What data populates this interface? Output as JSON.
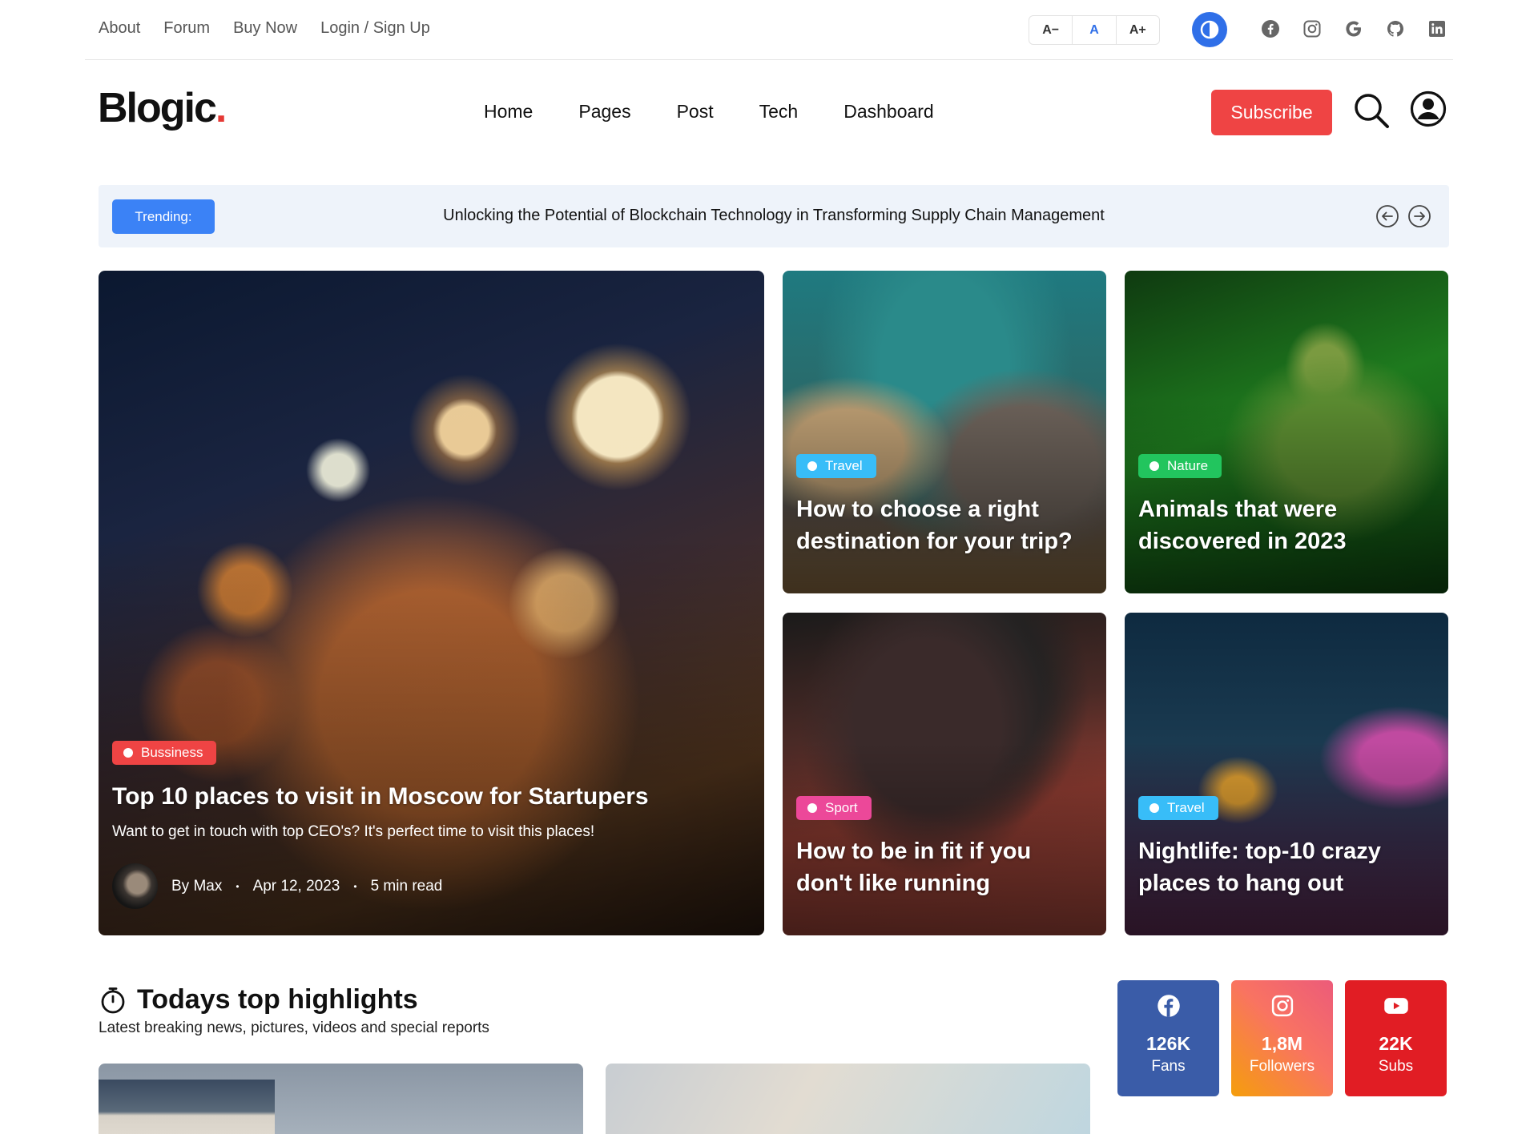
{
  "topbar": {
    "links": [
      "About",
      "Forum",
      "Buy Now",
      "Login / Sign Up"
    ],
    "font_size": {
      "decrease": "A−",
      "normal": "A",
      "increase": "A+"
    }
  },
  "header": {
    "logo": "Blogic",
    "logo_dot": ".",
    "nav": [
      "Home",
      "Pages",
      "Post",
      "Tech",
      "Dashboard"
    ],
    "subscribe_label": "Subscribe"
  },
  "trending": {
    "label": "Trending:",
    "headline": "Unlocking the Potential of Blockchain Technology in Transforming Supply Chain Management"
  },
  "featured": {
    "main": {
      "category": "Bussiness",
      "title": "Top 10 places to visit in Moscow for Startupers",
      "excerpt": "Want to get in touch with top CEO's? It's perfect time to visit this places!",
      "author": "By Max",
      "date": "Apr 12, 2023",
      "read_time": "5 min read",
      "meta_sep": "•"
    },
    "cards": [
      {
        "category": "Travel",
        "title": "How to choose a right destination for your trip?"
      },
      {
        "category": "Nature",
        "title": "Animals that were discovered in 2023"
      },
      {
        "category": "Sport",
        "title": "How to be in fit if you don't like running"
      },
      {
        "category": "Travel",
        "title": "Nightlife: top-10 crazy places to hang out"
      }
    ]
  },
  "highlights": {
    "title": "Todays top highlights",
    "subtitle": "Latest breaking news, pictures, videos and special reports"
  },
  "social_stats": [
    {
      "icon": "facebook-icon",
      "count": "126K",
      "label": "Fans",
      "color": "#3a5ca8"
    },
    {
      "icon": "instagram-icon",
      "count": "1,8M",
      "label": "Followers",
      "color": "#f97362"
    },
    {
      "icon": "youtube-icon",
      "count": "22K",
      "label": "Subs",
      "color": "#e11d24"
    }
  ],
  "colors": {
    "accent": "#2f6fe8",
    "subscribe": "#ef4444",
    "trending_badge": "#3b82f6",
    "badge_business": "#ef4444",
    "badge_travel": "#38bdf8",
    "badge_nature": "#22c55e",
    "badge_sport": "#ec4899"
  }
}
